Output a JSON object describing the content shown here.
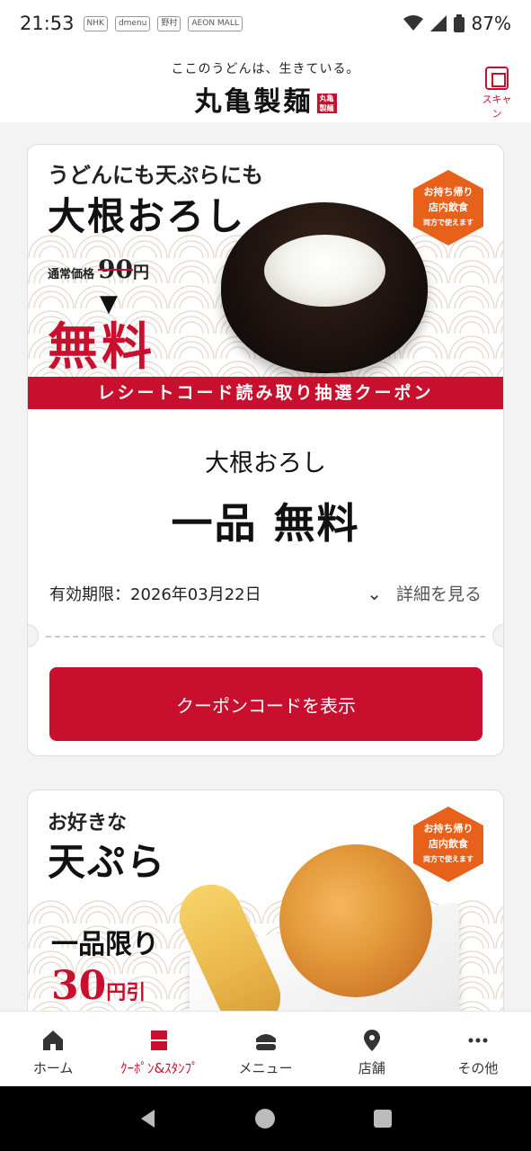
{
  "status_bar": {
    "time": "21:53",
    "notification_icons": [
      "NHK",
      "dmenu",
      "野村",
      "AEON MALL"
    ],
    "battery": "87%"
  },
  "header": {
    "tagline": "ここのうどんは、生きている。",
    "logo": "丸亀製麺",
    "logo_seal": "丸亀製麺",
    "scan_label": "スキャン"
  },
  "coupons": [
    {
      "banner": {
        "headline_small": "うどんにも天ぷらにも",
        "headline_big": "大根おろし",
        "regular_price_label": "通常価格",
        "regular_price": "90",
        "yen": "円",
        "arrow": "▼",
        "free": "無料",
        "badge_line1": "お持ち帰り",
        "badge_line2": "店内飲食",
        "badge_line3": "両方で使えます",
        "ribbon": "レシートコード読み取り抽選クーポン"
      },
      "title": "大根おろし",
      "discount": "一品 無料",
      "expiry": "有効期限：2026年03月22日",
      "details_label": "詳細を見る",
      "button_label": "クーポンコードを表示"
    },
    {
      "banner": {
        "headline_small": "お好きな",
        "headline_big": "天ぷら",
        "limit": "一品限り",
        "off_amount": "30",
        "off_suffix": "円引",
        "badge_line1": "お持ち帰り",
        "badge_line2": "店内飲食",
        "badge_line3": "両方で使えます"
      }
    }
  ],
  "tab_bar": {
    "items": [
      {
        "label": "ホーム",
        "icon": "home-icon"
      },
      {
        "label": "ｸｰﾎﾟﾝ&ｽﾀﾝﾌﾟ",
        "icon": "coupon-icon",
        "active": true
      },
      {
        "label": "メニュー",
        "icon": "menu-bowl-icon"
      },
      {
        "label": "店舗",
        "icon": "location-pin-icon"
      },
      {
        "label": "その他",
        "icon": "more-dots-icon"
      }
    ]
  },
  "colors": {
    "accent": "#c8102e",
    "badge": "#e8611a"
  }
}
